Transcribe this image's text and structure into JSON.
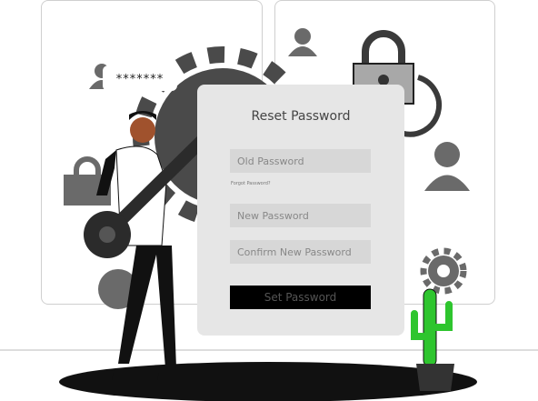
{
  "card": {
    "title": "Reset Password",
    "old_password_placeholder": "Old Password",
    "forgot_link": "Forgot Password?",
    "new_password_placeholder": "New Password",
    "confirm_password_placeholder": "Confirm New Password",
    "submit_label": "Set Password"
  },
  "bubble": {
    "text": "*******"
  },
  "icons": [
    "gear-icon",
    "padlock-icon",
    "refresh-icon",
    "user-icon",
    "key-icon",
    "cactus-icon"
  ],
  "colors": {
    "card": "#e6e6e6",
    "field": "#d7d7d7",
    "button": "#000000",
    "gear": "#4a4a4a",
    "cactus": "#2ec52e"
  }
}
